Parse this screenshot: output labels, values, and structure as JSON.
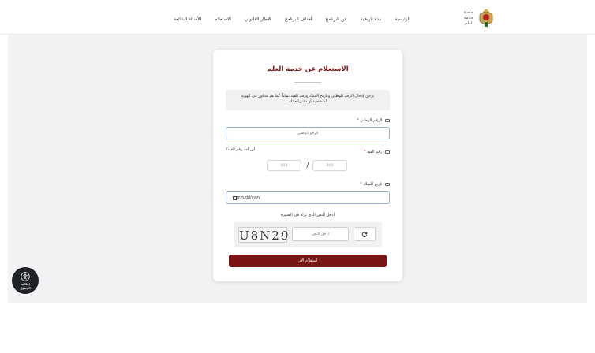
{
  "header": {
    "logo_lines": [
      "منصة",
      "خدمة",
      "العلم"
    ],
    "nav": [
      "الرئيسية",
      "نبذة تاريخية",
      "عن البرنامج",
      "أهداف البرنامج",
      "الإطار القانوني",
      "الاستعلام",
      "الأسئلة الشائعة"
    ]
  },
  "form": {
    "title": "الاستعلام عن خدمة العلم",
    "info_text": "يرجى إدخال الرقم الوطني وتاريخ الميلاد ورقم القيد تماماً كما هو مذكور في الهوية الشخصية أو دفتر العائلة.",
    "national_id_label": "الرقم الوطني",
    "national_id_placeholder": "الرقم الوطني",
    "registry_label": "رقم القيد",
    "registry_help": "أين أجد رقم القيد؟",
    "registry_placeholder_a": "000",
    "registry_placeholder_b": "000",
    "registry_separator": "/",
    "dob_label": "تاريخ الميلاد",
    "dob_value": "mm/dd/yyyy",
    "required_mark": "*",
    "captcha_title": "أدخل النص الذي تراه في الصورة",
    "captcha_text": "U8N29",
    "captcha_placeholder": "أدخل النص",
    "submit_label": "استعلام الآن"
  },
  "accessibility": {
    "line1": "إمكانية",
    "line2": "الوصول"
  },
  "colors": {
    "brand": "#7a1515",
    "title": "#7a1818",
    "field_border": "#9aaed6"
  }
}
